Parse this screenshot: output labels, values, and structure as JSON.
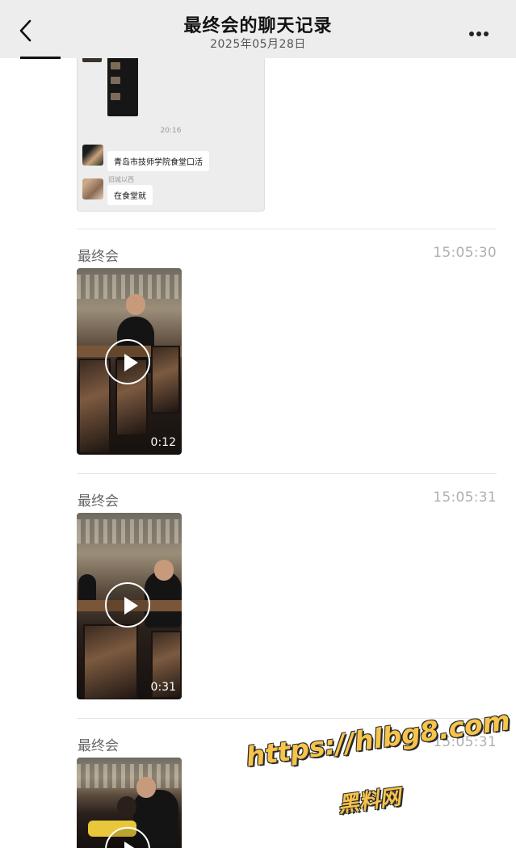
{
  "header": {
    "title": "最终会的聊天记录",
    "date": "2025年05月28日"
  },
  "embedded_chat": {
    "time": "20:16",
    "messages": [
      {
        "sender_name": "",
        "text": "青岛市技师学院食堂口活"
      },
      {
        "sender_name": "旧城以西",
        "text": "在食堂就"
      }
    ]
  },
  "messages": [
    {
      "sender": "最终会",
      "time": "15:05:30",
      "type": "video",
      "duration": "0:12"
    },
    {
      "sender": "最终会",
      "time": "15:05:31",
      "type": "video",
      "duration": "0:31"
    },
    {
      "sender": "最终会",
      "time": "15:05:31",
      "type": "video",
      "duration": ""
    }
  ],
  "watermark": {
    "url": "https://hlbg8.com",
    "name": "黑料网"
  },
  "colors": {
    "header_bg": "#ededed",
    "timestamp": "#b0b0b0",
    "watermark": "#f7c44a"
  },
  "icons": [
    "back-chevron-icon",
    "more-dots-icon",
    "play-icon"
  ]
}
